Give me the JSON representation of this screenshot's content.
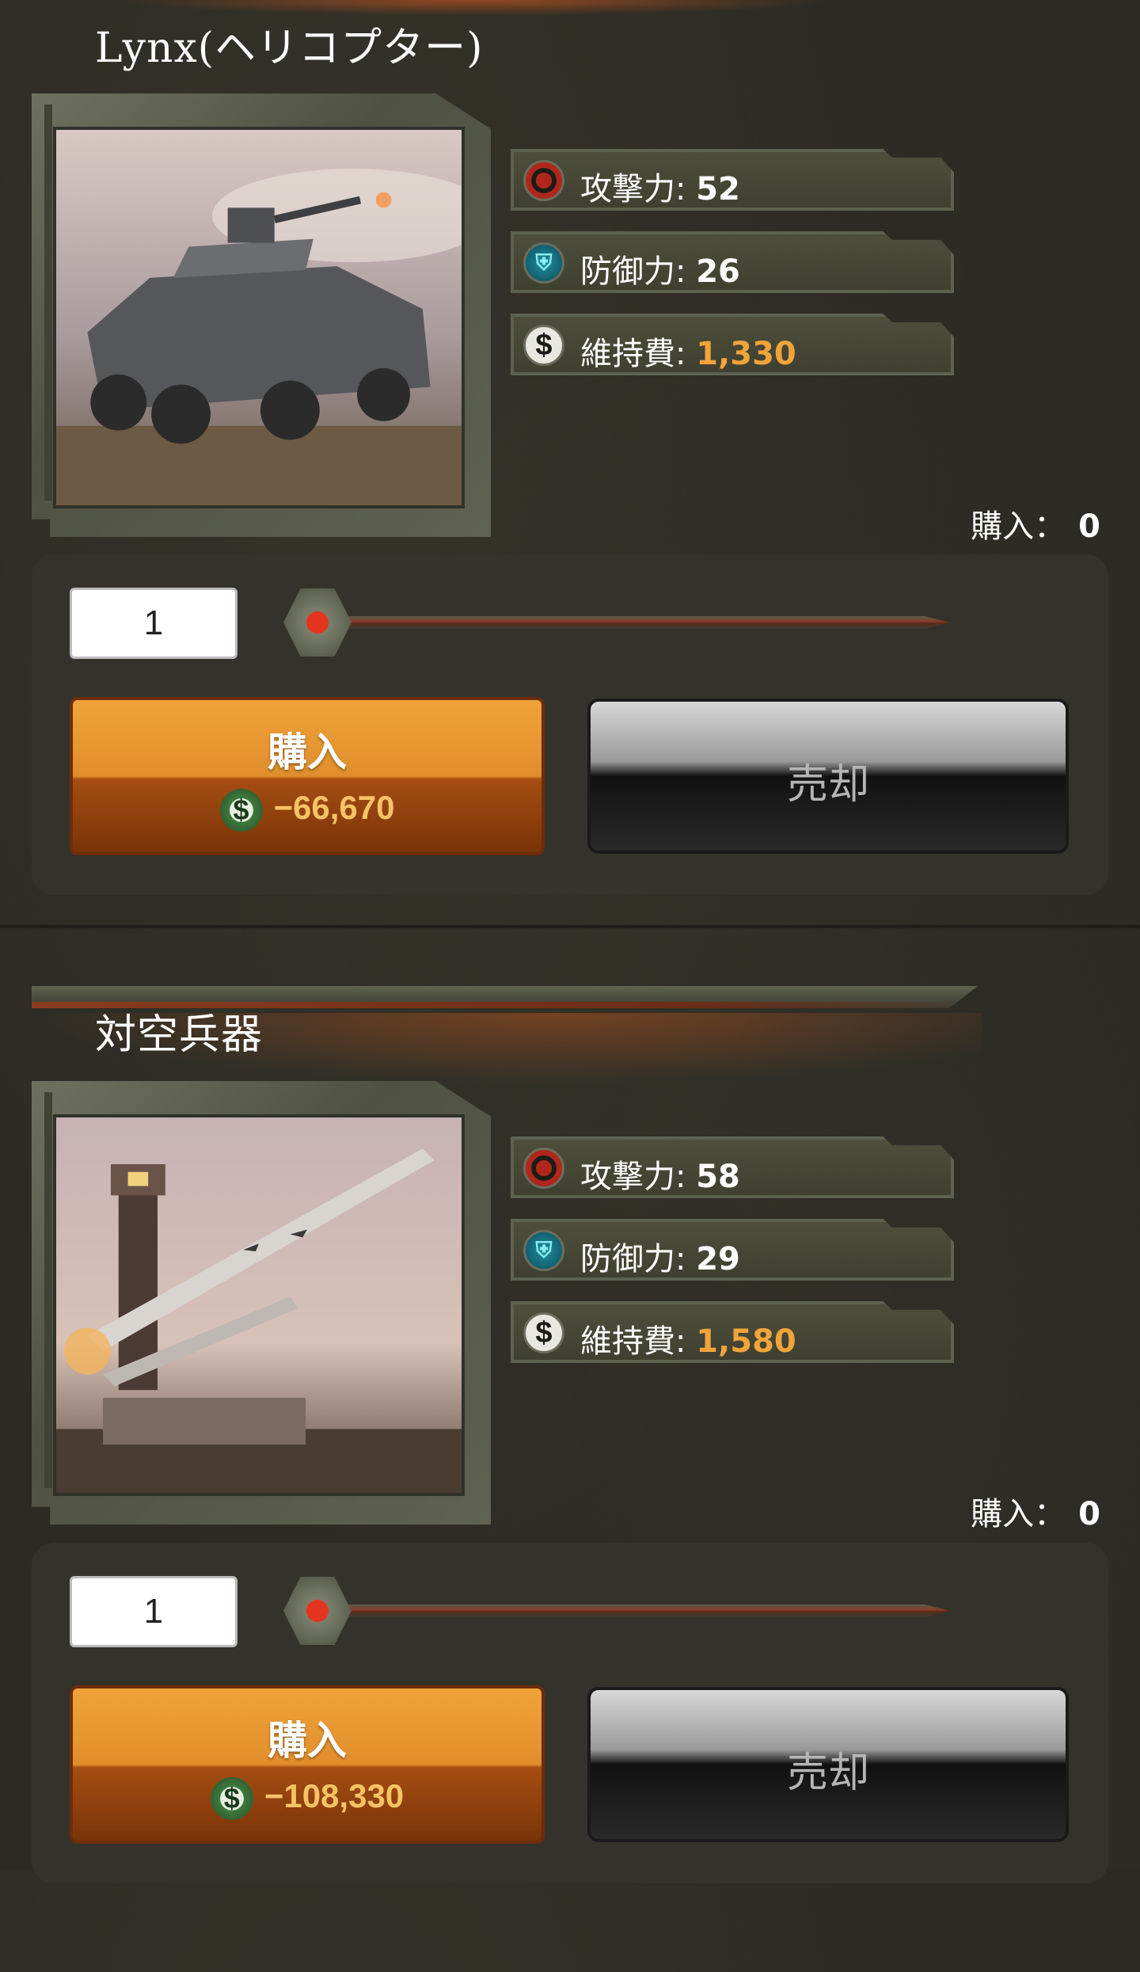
{
  "items": [
    {
      "title": "Lynx(ヘリコプター)",
      "attack_label": "攻撃力:",
      "attack_value": "52",
      "defense_label": "防御力:",
      "defense_value": "26",
      "upkeep_label": "維持費:",
      "upkeep_value": "1,330",
      "owned_label": "購入：",
      "owned_value": "0",
      "quantity": "1",
      "slider_value": 0,
      "buy_label": "購入",
      "buy_cost": "−66,670",
      "sell_label": "売却"
    },
    {
      "title": "対空兵器",
      "attack_label": "攻撃力:",
      "attack_value": "58",
      "defense_label": "防御力:",
      "defense_value": "29",
      "upkeep_label": "維持費:",
      "upkeep_value": "1,580",
      "owned_label": "購入：",
      "owned_value": "0",
      "quantity": "1",
      "slider_value": 0,
      "buy_label": "購入",
      "buy_cost": "−108,330",
      "sell_label": "売却"
    }
  ],
  "icons": {
    "attack": "crosshair-icon",
    "defense": "shield-icon",
    "upkeep": "dollar-icon",
    "cost": "dollar-coin-icon"
  },
  "colors": {
    "gold_value": "#f0a43a",
    "buy_button": "#e08e2c",
    "sell_button": "#2a2a2a"
  }
}
